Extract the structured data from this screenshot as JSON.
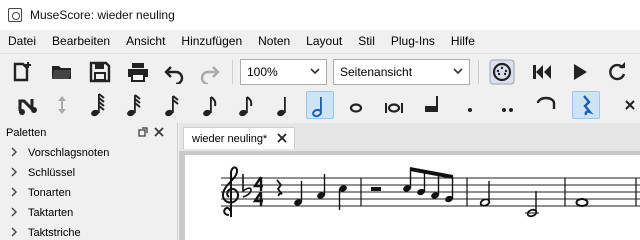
{
  "window": {
    "title": "MuseScore: wieder neuling"
  },
  "menu": [
    {
      "label": "Datei"
    },
    {
      "label": "Bearbeiten"
    },
    {
      "label": "Ansicht"
    },
    {
      "label": "Hinzufügen"
    },
    {
      "label": "Noten"
    },
    {
      "label": "Layout"
    },
    {
      "label": "Stil"
    },
    {
      "label": "Plug-Ins"
    },
    {
      "label": "Hilfe"
    }
  ],
  "toolbar": {
    "zoom_value": "100%",
    "view_mode_value": "Seitenansicht",
    "icons": [
      "new-score-icon",
      "open-icon",
      "save-icon",
      "print-icon",
      "undo-icon",
      "redo-icon",
      "midi-input-icon",
      "rewind-icon",
      "play-icon",
      "loop-icon"
    ]
  },
  "note_input": {
    "icons": [
      "note-input-icon",
      "voice-arrows-icon",
      "64th-note-icon",
      "32nd-note-icon",
      "16th-note-icon",
      "eighth-note-icon",
      "quarter-note-icon",
      "half-note-icon",
      "whole-note-icon",
      "breve-icon",
      "longa-icon",
      "dot-icon",
      "double-dot-icon",
      "tie-icon",
      "rest-icon",
      "flip-direction-icon"
    ],
    "active": "half-note-icon"
  },
  "palettes": {
    "title": "Paletten",
    "items": [
      {
        "label": "Vorschlagsnoten"
      },
      {
        "label": "Schlüssel"
      },
      {
        "label": "Tonarten"
      },
      {
        "label": "Taktarten"
      },
      {
        "label": "Taktstriche"
      }
    ]
  },
  "score_tab": {
    "label": "wieder neuling*"
  },
  "score": {
    "clef": "treble",
    "key_signature": "1 flat",
    "time_signature": "4/4"
  }
}
